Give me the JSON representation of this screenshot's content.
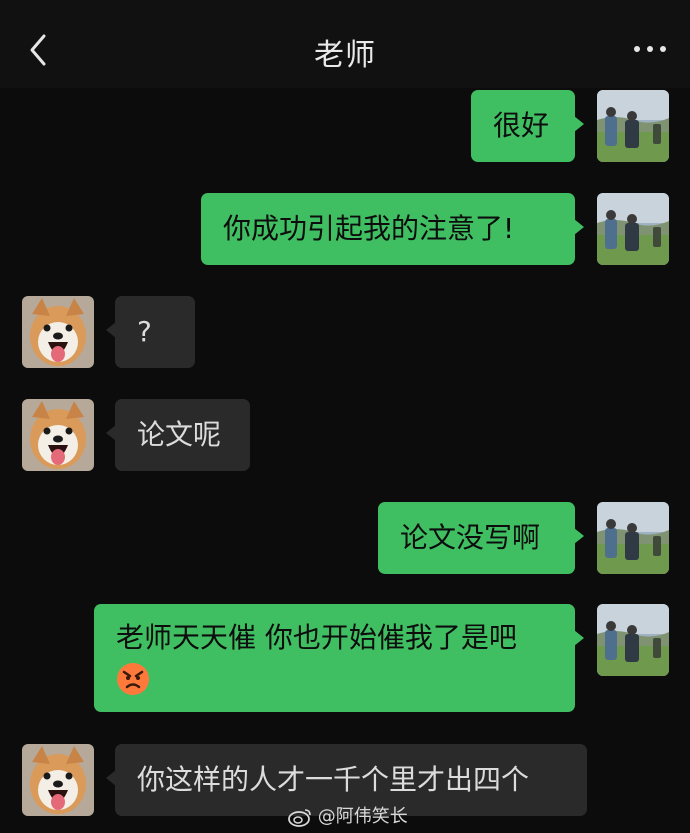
{
  "header": {
    "title": "老师",
    "back_icon": "chevron-left-icon",
    "more_icon": "more-dots-icon"
  },
  "messages": [
    {
      "side": "out",
      "text": "很好"
    },
    {
      "side": "out",
      "text": "你成功引起我的注意了!"
    },
    {
      "side": "in",
      "text": "?"
    },
    {
      "side": "in",
      "text": "论文呢"
    },
    {
      "side": "out",
      "text": "论文没写啊"
    },
    {
      "side": "out",
      "text": "老师天天催 你也开始催我了是吧",
      "emoji": "angry-face-icon"
    },
    {
      "side": "in",
      "text": "你这样的人才一千个里才出四个"
    }
  ],
  "watermark": {
    "text": "@阿伟笑长",
    "icon": "weibo-icon"
  },
  "colors": {
    "background": "#0c0c0c",
    "outgoing_bubble": "#3fbf62",
    "incoming_bubble": "#2a2a2a"
  }
}
